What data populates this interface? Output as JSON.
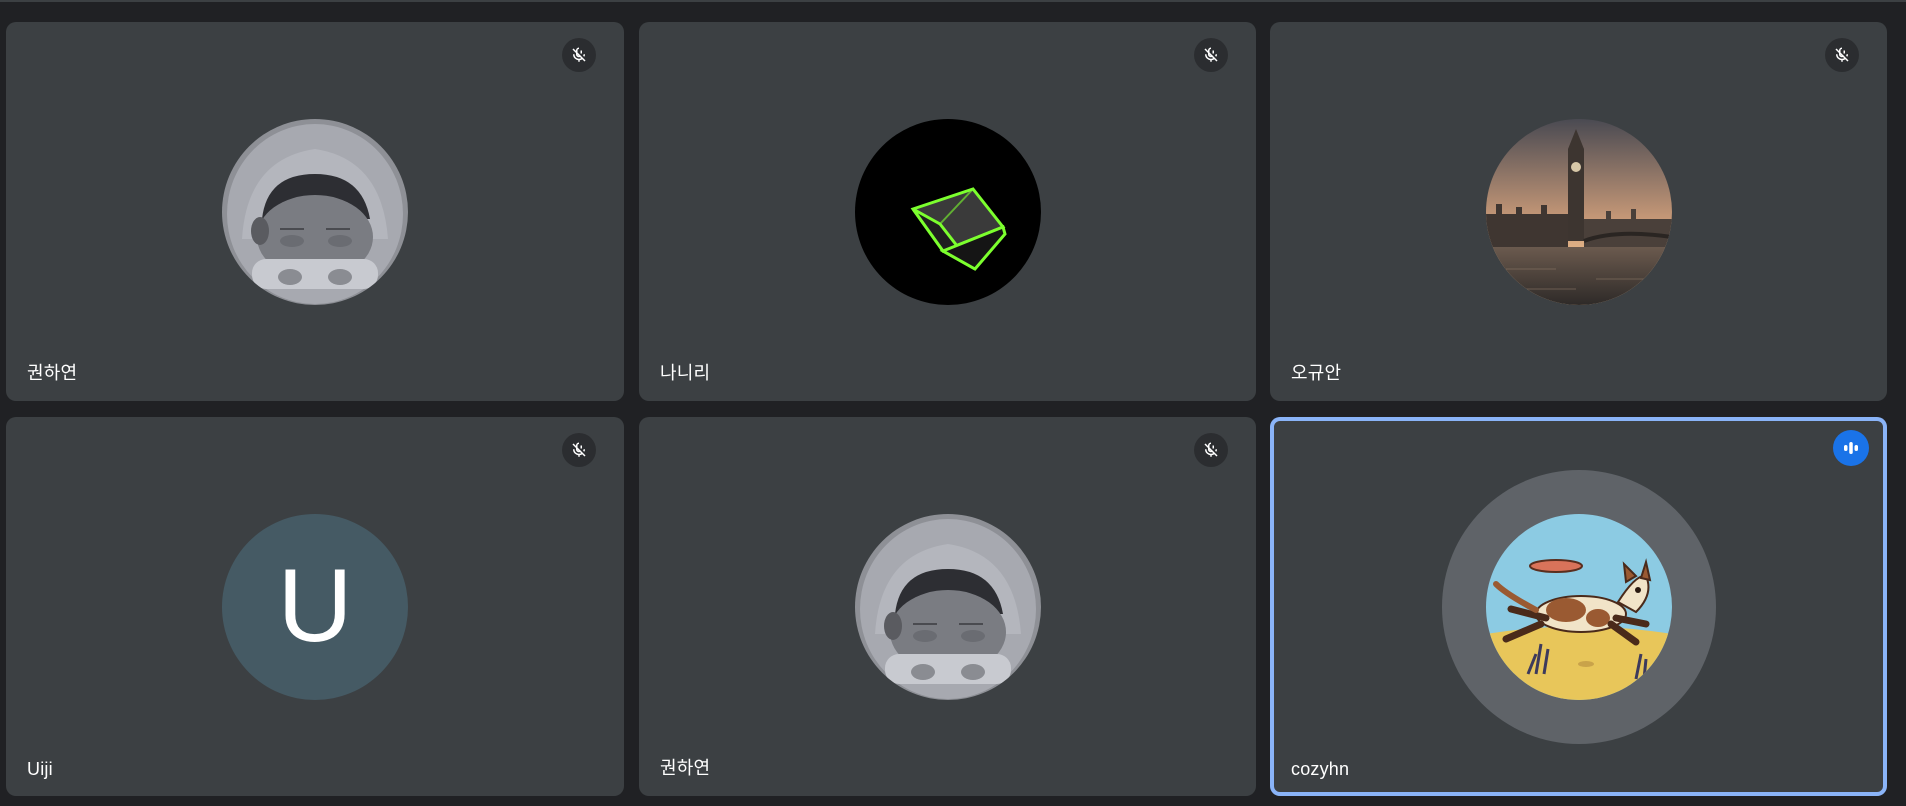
{
  "participants": [
    {
      "name": "권하연",
      "avatar_icon": "hooded-character-icon",
      "muted": true
    },
    {
      "name": "나니리",
      "avatar_icon": "neon-cube-icon",
      "muted": true
    },
    {
      "name": "오규안",
      "avatar_icon": "big-ben-photo-icon",
      "muted": true
    },
    {
      "name": "Uiji",
      "avatar_letter": "U",
      "avatar_color": "#455a64",
      "muted": true
    },
    {
      "name": "권하연",
      "avatar_icon": "hooded-character-icon",
      "muted": true
    },
    {
      "name": "cozyhn",
      "avatar_icon": "dog-frisbee-icon",
      "muted": false,
      "speaking": true
    }
  ],
  "colors": {
    "background": "#202124",
    "tile": "#3c4043",
    "active_border": "#8ab4f8",
    "speaking_badge": "#1a73e8"
  }
}
